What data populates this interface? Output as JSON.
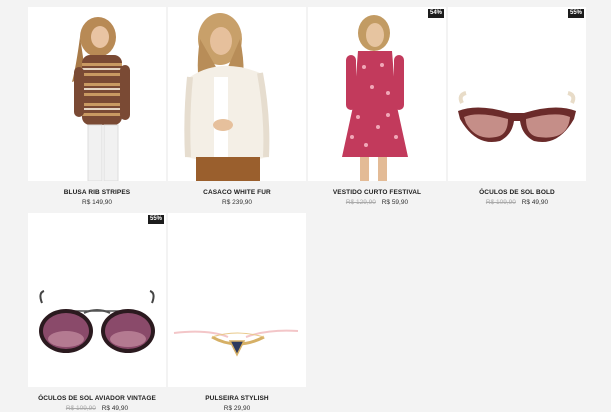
{
  "products": [
    {
      "title": "BLUSA RIB STRIPES",
      "price": "R$ 149,90",
      "old_price": "",
      "badge": ""
    },
    {
      "title": "CASACO WHITE FUR",
      "price": "R$ 239,90",
      "old_price": "",
      "badge": ""
    },
    {
      "title": "VESTIDO CURTO FESTIVAL",
      "price": "R$ 59,90",
      "old_price": "R$ 129,90",
      "badge": "54%"
    },
    {
      "title": "ÓCULOS DE SOL BOLD",
      "price": "R$ 49,90",
      "old_price": "R$ 109,90",
      "badge": "55%"
    },
    {
      "title": "ÓCULOS DE SOL AVIADOR VINTAGE",
      "price": "R$ 49,90",
      "old_price": "R$ 109,90",
      "badge": "55%"
    },
    {
      "title": "PULSEIRA STYLISH",
      "price": "R$ 29,90",
      "old_price": "",
      "badge": ""
    }
  ]
}
